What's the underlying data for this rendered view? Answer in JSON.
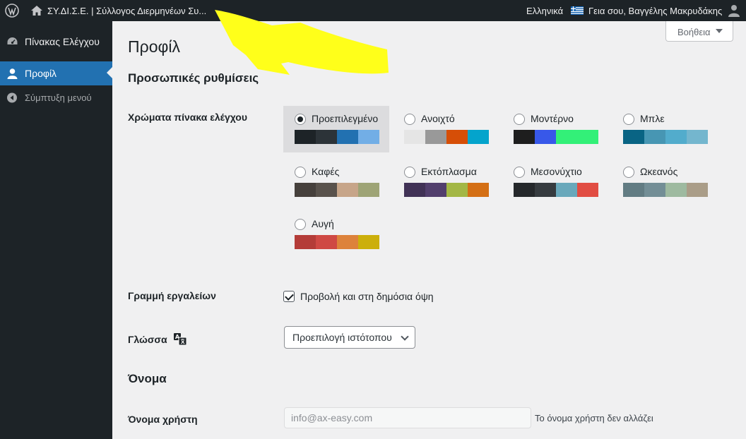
{
  "adminbar": {
    "site_name": "ΣΥ.ΔΙ.Σ.Ε. | Σύλλογος Διερμηνέων Συ...",
    "language": "Ελληνικά",
    "greeting": "Γεια σου, Βαγγέλης Μακρυδάκης"
  },
  "sidebar": {
    "items": [
      {
        "label": "Πίνακας Ελέγχου",
        "icon": "dashboard-icon"
      },
      {
        "label": "Προφίλ",
        "icon": "user-icon",
        "active": true
      },
      {
        "label": "Σύμπτυξη μενού",
        "icon": "collapse-icon"
      }
    ]
  },
  "help_label": "Βοήθεια",
  "page_title": "Προφίλ",
  "sections": {
    "personal": "Προσωπικές ρυθμίσεις",
    "name": "Όνομα"
  },
  "colors": {
    "label": "Χρώματα πίνακα ελέγχου",
    "schemes": [
      {
        "name": "Προεπιλεγμένο",
        "selected": true,
        "swatches": [
          "#1d2327",
          "#2c3338",
          "#2271b1",
          "#72aee6"
        ]
      },
      {
        "name": "Ανοιχτό",
        "selected": false,
        "swatches": [
          "#e5e5e5",
          "#999999",
          "#d64e07",
          "#04a4cc"
        ]
      },
      {
        "name": "Μοντέρνο",
        "selected": false,
        "swatches": [
          "#1e1e1e",
          "#3858e9",
          "#33f078",
          "#33f078"
        ]
      },
      {
        "name": "Μπλε",
        "selected": false,
        "swatches": [
          "#096484",
          "#4796b3",
          "#52accc",
          "#74b6ce"
        ]
      },
      {
        "name": "Καφές",
        "selected": false,
        "swatches": [
          "#46403c",
          "#59524c",
          "#c7a589",
          "#9ea476"
        ]
      },
      {
        "name": "Εκτόπλασμα",
        "selected": false,
        "swatches": [
          "#413256",
          "#523f6d",
          "#a3b745",
          "#d46f15"
        ]
      },
      {
        "name": "Μεσονύχτιο",
        "selected": false,
        "swatches": [
          "#25282b",
          "#363b3f",
          "#69a8bb",
          "#e14d43"
        ]
      },
      {
        "name": "Ωκεανός",
        "selected": false,
        "swatches": [
          "#627c83",
          "#738e96",
          "#9ebaa0",
          "#aa9d88"
        ]
      },
      {
        "name": "Αυγή",
        "selected": false,
        "swatches": [
          "#b43c38",
          "#cf4944",
          "#dd823b",
          "#ccaf0b"
        ]
      }
    ]
  },
  "toolbar": {
    "label": "Γραμμή εργαλείων",
    "checkbox_label": "Προβολή και στη δημόσια όψη",
    "checked": true
  },
  "language_row": {
    "label": "Γλώσσα",
    "selected": "Προεπιλογή ιστότοπου"
  },
  "username": {
    "label": "Όνομα χρήστη",
    "value": "info@ax-easy.com",
    "description": "Το όνομα χρήστη δεν αλλάζει"
  }
}
